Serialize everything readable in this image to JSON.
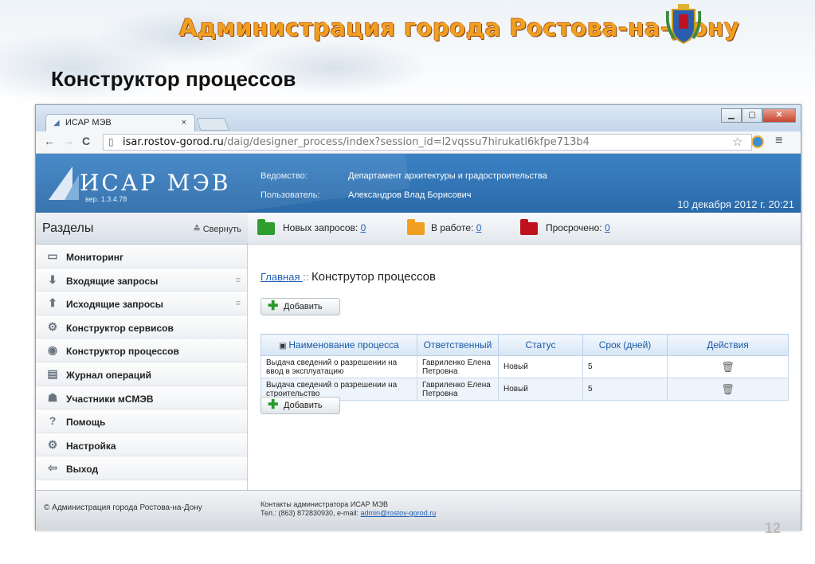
{
  "slide": {
    "header": "Администрация города Ростова-на-Дону",
    "title": "Конструктор процессов",
    "page_number": "12"
  },
  "browser": {
    "tab_title": "ИСАР МЭВ",
    "url_host": "isar.rostov-gorod.ru",
    "url_path": "/daig/designer_process/index?session_id=l2vqssu7hirukatl6kfpe713b4"
  },
  "app": {
    "logo": "ИСАР МЭВ",
    "version": "вер. 1.3.4.78",
    "dept_label": "Ведомство:",
    "dept_value": "Департамент архитектуры и градостроительства",
    "user_label": "Пользователь:",
    "user_value": "Александров Влад Борисович",
    "datetime": "10 декабря 2012 г.   20:21"
  },
  "sidebar": {
    "title": "Разделы",
    "collapse": "≙ Свернуть",
    "items": [
      {
        "label": "Мониторинг",
        "icon": "monitor-icon",
        "glyph": "▭"
      },
      {
        "label": "Входящие запросы",
        "icon": "inbox-icon",
        "glyph": "⬇",
        "expandable": true
      },
      {
        "label": "Исходящие запросы",
        "icon": "outbox-icon",
        "glyph": "⬆",
        "expandable": true
      },
      {
        "label": "Конструктор сервисов",
        "icon": "gear-icon",
        "glyph": "⚙"
      },
      {
        "label": "Конструктор процессов",
        "icon": "process-icon",
        "glyph": "◉"
      },
      {
        "label": "Журнал операций",
        "icon": "journal-icon",
        "glyph": "▤"
      },
      {
        "label": "Участники мСМЭВ",
        "icon": "users-icon",
        "glyph": "☗"
      },
      {
        "label": "Помощь",
        "icon": "help-icon",
        "glyph": "?"
      },
      {
        "label": "Настройка",
        "icon": "settings-icon",
        "glyph": "⚙"
      },
      {
        "label": "Выход",
        "icon": "exit-icon",
        "glyph": "⇦"
      }
    ]
  },
  "toolbar": {
    "new_label": "Новых запросов:",
    "new_count": "0",
    "work_label": "В работе:",
    "work_count": "0",
    "overdue_label": "Просрочено:",
    "overdue_count": "0",
    "colors": {
      "new": "#2e9e2e",
      "work": "#f0a020",
      "overdue": "#c0121e"
    }
  },
  "content": {
    "breadcrumb_link": "Главная ",
    "breadcrumb_sep": ":: ",
    "breadcrumb_current": "Конструтор процессов",
    "add_label": "Добавить",
    "columns": [
      "Наименование процесса",
      "Ответственный",
      "Статус",
      "Срок (дней)",
      "Действия"
    ],
    "rows": [
      {
        "name": "Выдача сведений о разрешении на ввод в эксплуатацию",
        "owner": "Гавриленко Елена Петровна",
        "status": "Новый",
        "days": "5"
      },
      {
        "name": "Выдача сведений о разрешении на строительство",
        "owner": "Гавриленко Елена Петровна",
        "status": "Новый",
        "days": "5"
      }
    ]
  },
  "footer": {
    "copyright": "© Администрация города Ростова-на-Дону",
    "contacts_line1": "Контакты администратора ИСАР МЭВ",
    "contacts_line2": "Тел.: (863) 872830930, e-mail: ",
    "email": "admin@rostov-gorod.ru"
  }
}
